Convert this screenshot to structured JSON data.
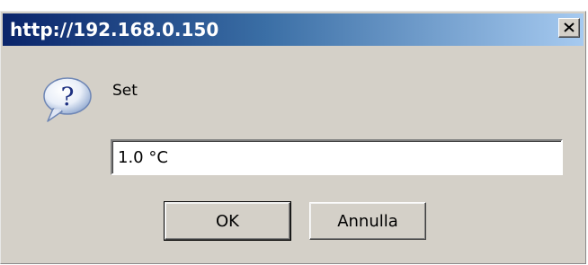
{
  "window": {
    "title": "http://192.168.0.150",
    "close_icon": "close-icon",
    "titlebar_color_start": "#0a246a",
    "titlebar_color_end": "#a6caf0",
    "background_color": "#d4d0c8"
  },
  "dialog": {
    "icon": "question-icon",
    "prompt": "Set",
    "input_value": "1.0 °C"
  },
  "buttons": {
    "ok_label": "OK",
    "cancel_label": "Annulla"
  }
}
